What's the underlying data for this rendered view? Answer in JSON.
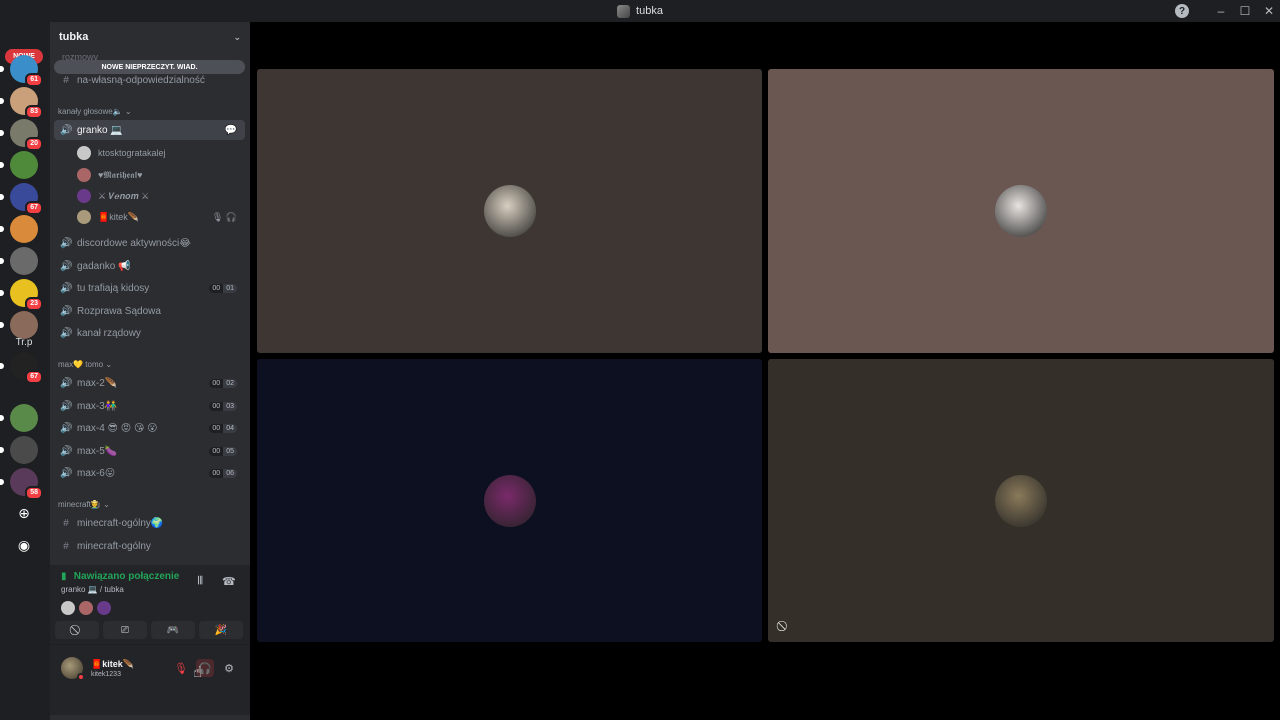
{
  "window": {
    "title": "tubka"
  },
  "guilds": {
    "new_label": "NOWE",
    "items": [
      {
        "name": "server-1",
        "badge": "61",
        "color": "#3a8ec9"
      },
      {
        "name": "server-2",
        "badge": "83",
        "color": "#c9a07a"
      },
      {
        "name": "server-3",
        "badge": "20",
        "color": "#7a7a6a"
      },
      {
        "name": "server-4",
        "badge": "",
        "color": "#4f8a3a"
      },
      {
        "name": "server-5",
        "badge": "67",
        "color": "#3a4a9a"
      },
      {
        "name": "server-6",
        "badge": "",
        "color": "#d98a3a"
      },
      {
        "name": "server-7",
        "badge": "",
        "color": "#6a6a6a"
      },
      {
        "name": "server-8",
        "badge": "23",
        "color": "#e8c020"
      },
      {
        "name": "server-9",
        "badge": "",
        "color": "#8a6a5a"
      },
      {
        "name": "server-10",
        "badge": "67",
        "color": "#222222"
      },
      {
        "name": "server-11",
        "badge": "",
        "color": "#5a8a4a"
      },
      {
        "name": "server-12",
        "badge": "",
        "color": "#4a4a4a"
      },
      {
        "name": "server-13",
        "badge": "58",
        "color": "#5a3a5a"
      }
    ],
    "text_server": "Tr.p"
  },
  "sidebar": {
    "server_name": "tubka",
    "unread_banner": "NOWE NIEPRZECZYT. WIAD.",
    "ghost_channel": "rozmowy",
    "channel_top": "na-własną-odpowiedzialność",
    "cat_voice": "kanały głosowe🔈",
    "active_channel": "granko 💻",
    "members": [
      {
        "name": "ktosktogratakalej",
        "color": "#c8c8c8"
      },
      {
        "name": "♥𝕸𝖆𝖗𝖎𝖍𝖊𝖆𝖑♥",
        "color": "#a66"
      },
      {
        "name": "⚔ 𝑽𝒆𝒏𝒐𝒎 ⚔",
        "color": "#6a3a8a"
      },
      {
        "name": "🧧kitek🪶",
        "color": "#a89a7a"
      }
    ],
    "channels_voice": [
      {
        "name": "discordowe aktywności😂"
      },
      {
        "name": "gadanko 📢"
      },
      {
        "name": "tu trafiają kidosy",
        "a": "00",
        "b": "01"
      },
      {
        "name": "Rozprawa Sądowa"
      },
      {
        "name": "kanał rządowy"
      }
    ],
    "cat_max": "max💛 tomo",
    "channels_max": [
      {
        "name": "max-2🪶",
        "a": "00",
        "b": "02"
      },
      {
        "name": "max-3👫",
        "a": "00",
        "b": "03"
      },
      {
        "name": "max-4 😎 😡 😘 😮",
        "a": "00",
        "b": "04"
      },
      {
        "name": "max-5🍆",
        "a": "00",
        "b": "05"
      },
      {
        "name": "max-6😛",
        "a": "00",
        "b": "06"
      }
    ],
    "cat_minecraft": "minecraft👨‍🌾",
    "channels_mc": [
      {
        "name": "minecraft-ogólny🌍"
      },
      {
        "name": "minecraft-ogólny"
      }
    ]
  },
  "voice_panel": {
    "status": "Nawiązano połączenie",
    "location": "granko 💻 / tubka"
  },
  "user_panel": {
    "name": "🧧kitek🪶",
    "tag": "kitek1233"
  },
  "tiles": [
    {
      "name": "tile-1",
      "bg": "#3d3632",
      "avatar": "#d8cfc0"
    },
    {
      "name": "tile-2",
      "bg": "#6b5751",
      "avatar": "#e8e4e0"
    },
    {
      "name": "tile-3",
      "bg": "#0d1020",
      "avatar": "#7a2a6a"
    },
    {
      "name": "tile-4",
      "bg": "#343029",
      "avatar": "#8a7a5a"
    }
  ]
}
